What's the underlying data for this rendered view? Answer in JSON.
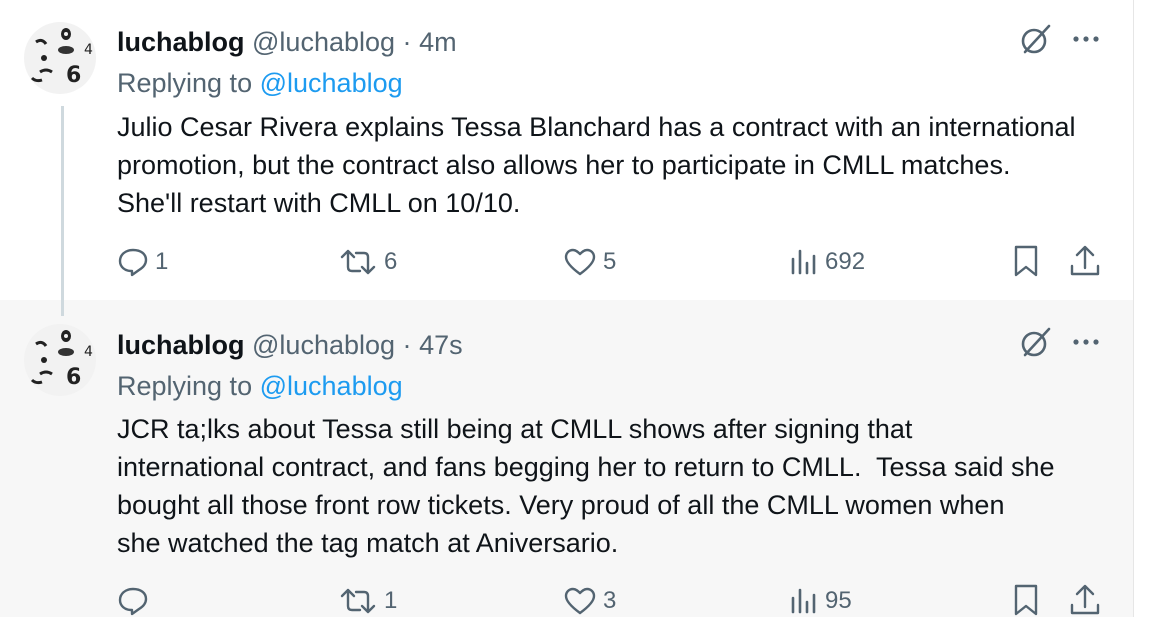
{
  "tweets": [
    {
      "name": "luchablog",
      "handle": "@luchablog",
      "separator": "·",
      "time": "4m",
      "replying_prefix": "Replying to",
      "replying_to": "@luchablog",
      "text": "Julio Cesar Rivera explains Tessa Blanchard has a contract with an international\npromotion, but the contract also allows her to participate in CMLL matches.\nShe'll restart with CMLL on 10/10.",
      "replies": "1",
      "reposts": "6",
      "likes": "5",
      "views": "692"
    },
    {
      "name": "luchablog",
      "handle": "@luchablog",
      "separator": "·",
      "time": "47s",
      "replying_prefix": "Replying to",
      "replying_to": "@luchablog",
      "text": "JCR ta;lks about Tessa still being at CMLL shows after signing that\ninternational contract, and fans begging her to return to CMLL.  Tessa said she\nbought all those front row tickets. Very proud of all the CMLL women when\nshe watched the tag match at Aniversario.",
      "replies": "",
      "reposts": "1",
      "likes": "3",
      "views": "95"
    }
  ],
  "icons": {
    "grok": "grok-icon",
    "more": "more-icon",
    "reply": "reply-icon",
    "repost": "repost-icon",
    "like": "like-icon",
    "views": "views-icon",
    "bookmark": "bookmark-icon",
    "share": "share-icon"
  },
  "colors": {
    "accent": "#1d9bf0",
    "secondary_text": "#536471",
    "primary_text": "#0f1419"
  }
}
